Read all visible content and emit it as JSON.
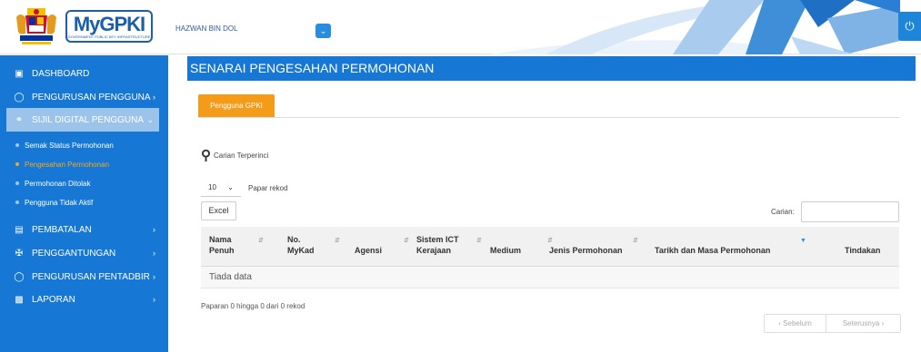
{
  "header": {
    "logo_text": "MyGPKI",
    "logo_sub": "GOVERNMENT PUBLIC KEY INFRASTRUCTURE",
    "user_name": "HAZWAN BIN DOL"
  },
  "sidebar": {
    "items": [
      {
        "label": "DASHBOARD",
        "icon": "monitor-icon"
      },
      {
        "label": "PENGURUSAN PENGGUNA",
        "icon": "user-icon"
      },
      {
        "label": "SIJIL DIGITAL PENGGUNA",
        "icon": "key-icon"
      },
      {
        "label": "PEMBATALAN",
        "icon": "list-icon"
      },
      {
        "label": "PENGGANTUNGAN",
        "icon": "sitemap-icon"
      },
      {
        "label": "PENGURUSAN PENTADBIR",
        "icon": "user-icon"
      },
      {
        "label": "LAPORAN",
        "icon": "bar-chart-icon"
      }
    ],
    "sub_items": [
      "Semak Status Permohonan",
      "Pengesahan Permohonan",
      "Permohonan Ditolak",
      "Pengguna Tidak Aktif"
    ]
  },
  "main": {
    "title": "SENARAI PENGESAHAN PERMOHONAN",
    "tab": "Pengguna GPKI",
    "advanced_search": "Carian Terperinci",
    "page_length": "10",
    "page_length_label": "Papar rekod",
    "excel_button": "Excel",
    "search_label": "Carian:",
    "table": {
      "columns": [
        "Nama Penuh",
        "No. MyKad",
        "Agensi",
        "Sistem ICT Kerajaan",
        "Medium",
        "Jenis Permohonan",
        "Tarikh dan Masa Permohonan",
        "Tindakan"
      ],
      "empty": "Tiada data"
    },
    "info": "Paparan 0 hingga 0 dari 0 rekod",
    "pager": {
      "prev": "‹ Sebelum",
      "next": "Seterusnya ›"
    }
  },
  "colors": {
    "primary": "#1678d4",
    "accent": "#f49b19",
    "active_nav": "#9cc4ea"
  }
}
